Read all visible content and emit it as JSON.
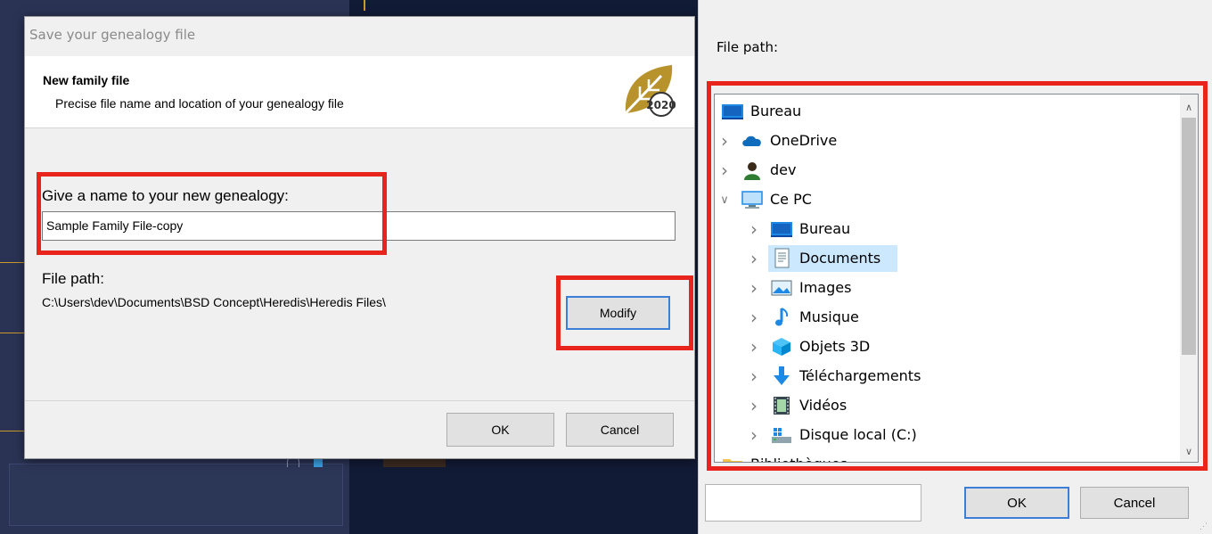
{
  "save_dialog": {
    "title": "Save your genealogy file",
    "header_title": "New family file",
    "header_subtitle": "Precise file name and location of your genealogy file",
    "logo_badge": "2020",
    "name_label": "Give a name to your new genealogy:",
    "name_value": "Sample Family File-copy",
    "path_label": "File path:",
    "path_value": "C:\\Users\\dev\\Documents\\BSD Concept\\Heredis\\Heredis Files\\",
    "modify_label": "Modify",
    "ok_label": "OK",
    "cancel_label": "Cancel"
  },
  "folder_dialog": {
    "path_label": "File path:",
    "tree": [
      {
        "label": "Bureau",
        "icon": "desktop-icon",
        "expand": "",
        "selected": false
      },
      {
        "label": "OneDrive",
        "icon": "cloud-icon",
        "expand": ">",
        "selected": false
      },
      {
        "label": "dev",
        "icon": "user-icon",
        "expand": ">",
        "selected": false
      },
      {
        "label": "Ce PC",
        "icon": "computer-icon",
        "expand": "v",
        "selected": false
      },
      {
        "label": "Bureau",
        "icon": "desktop-icon",
        "expand": ">",
        "selected": false
      },
      {
        "label": "Documents",
        "icon": "documents-icon",
        "expand": ">",
        "selected": true
      },
      {
        "label": "Images",
        "icon": "images-icon",
        "expand": ">",
        "selected": false
      },
      {
        "label": "Musique",
        "icon": "music-icon",
        "expand": ">",
        "selected": false
      },
      {
        "label": "Objets 3D",
        "icon": "cube-icon",
        "expand": ">",
        "selected": false
      },
      {
        "label": "Téléchargements",
        "icon": "download-icon",
        "expand": ">",
        "selected": false
      },
      {
        "label": "Vidéos",
        "icon": "video-icon",
        "expand": ">",
        "selected": false
      },
      {
        "label": "Disque local (C:)",
        "icon": "drive-icon",
        "expand": ">",
        "selected": false
      },
      {
        "label": "Bibliothèques",
        "icon": "folder-icon",
        "expand": "",
        "selected": false
      }
    ],
    "ok_label": "OK",
    "cancel_label": "Cancel"
  },
  "highlight_color": "#e8241c"
}
